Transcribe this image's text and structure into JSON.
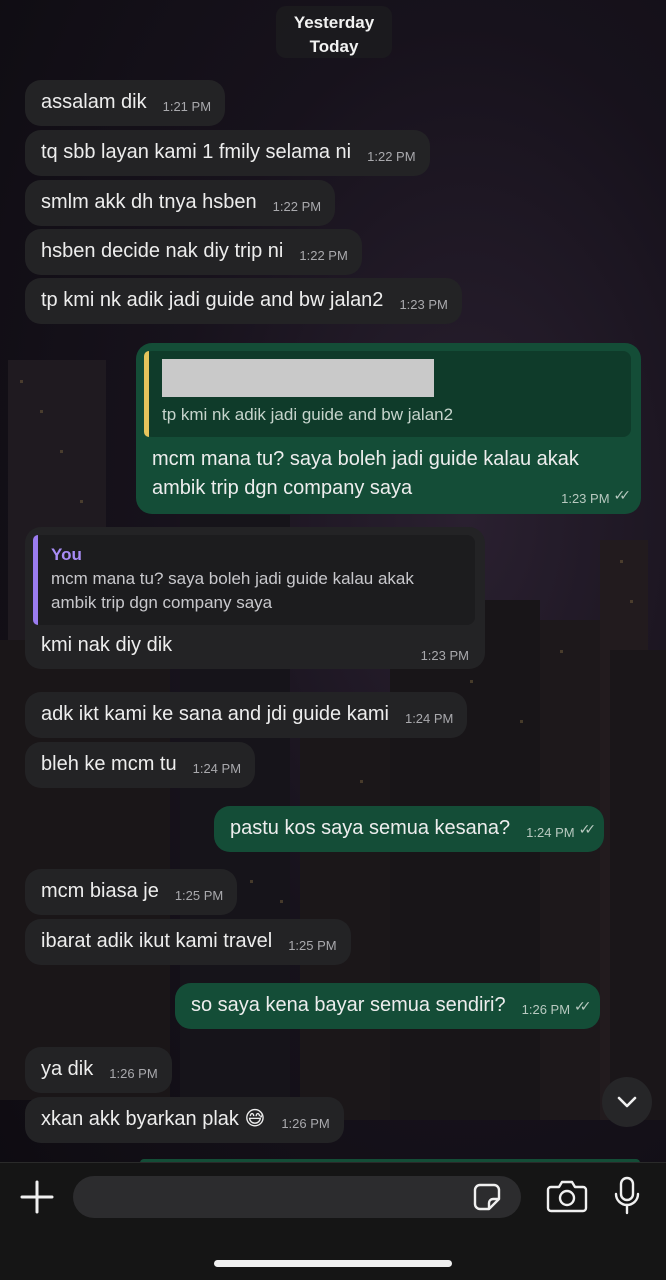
{
  "date_pill": {
    "line1": "Yesterday",
    "line2": "Today"
  },
  "messages": [
    {
      "text": "assalam dik",
      "time": "1:21 PM"
    },
    {
      "text": "tq sbb layan kami 1 fmily selama ni",
      "time": "1:22 PM"
    },
    {
      "text": "smlm akk dh tnya hsben",
      "time": "1:22 PM"
    },
    {
      "text": "hsben decide nak diy trip ni",
      "time": "1:22 PM"
    },
    {
      "text": "tp kmi nk adik jadi guide and bw jalan2",
      "time": "1:23 PM"
    },
    {
      "quote": "tp kmi nk adik jadi guide and bw jalan2",
      "text_line1": "mcm mana tu? saya boleh jadi guide kalau akak",
      "text_line2": "ambik trip dgn company saya",
      "time": "1:23 PM"
    },
    {
      "quote_name": "You",
      "quote_line1": "mcm mana tu? saya boleh jadi guide kalau akak",
      "quote_line2": "ambik trip dgn company saya",
      "text": "kmi nak diy dik",
      "time": "1:23 PM"
    },
    {
      "text": "adk ikt kami ke sana and jdi guide kami",
      "time": "1:24 PM"
    },
    {
      "text": "bleh ke mcm tu",
      "time": "1:24 PM"
    },
    {
      "text": "pastu kos saya semua kesana?",
      "time": "1:24 PM"
    },
    {
      "text": "mcm biasa je",
      "time": "1:25 PM"
    },
    {
      "text": "ibarat adik ikut kami travel",
      "time": "1:25 PM"
    },
    {
      "text": "so saya kena bayar semua sendiri?",
      "time": "1:26 PM"
    },
    {
      "text": "ya dik",
      "time": "1:26 PM"
    },
    {
      "text": "xkan akk byarkan plak",
      "emoji": "😅",
      "time": "1:26 PM"
    }
  ],
  "composer": {
    "placeholder": ""
  },
  "icons": {
    "read_receipt": "double-check-icon",
    "scroll": "chevron-down-icon",
    "attach": "plus-icon",
    "sticker": "sticker-icon",
    "camera": "camera-icon",
    "voice": "microphone-icon"
  },
  "colors": {
    "incoming_bubble": "#232325",
    "outgoing_bubble": "#144d37",
    "quote_bar_you": "#9b7cf0",
    "quote_bar_other": "#e6c55c"
  }
}
